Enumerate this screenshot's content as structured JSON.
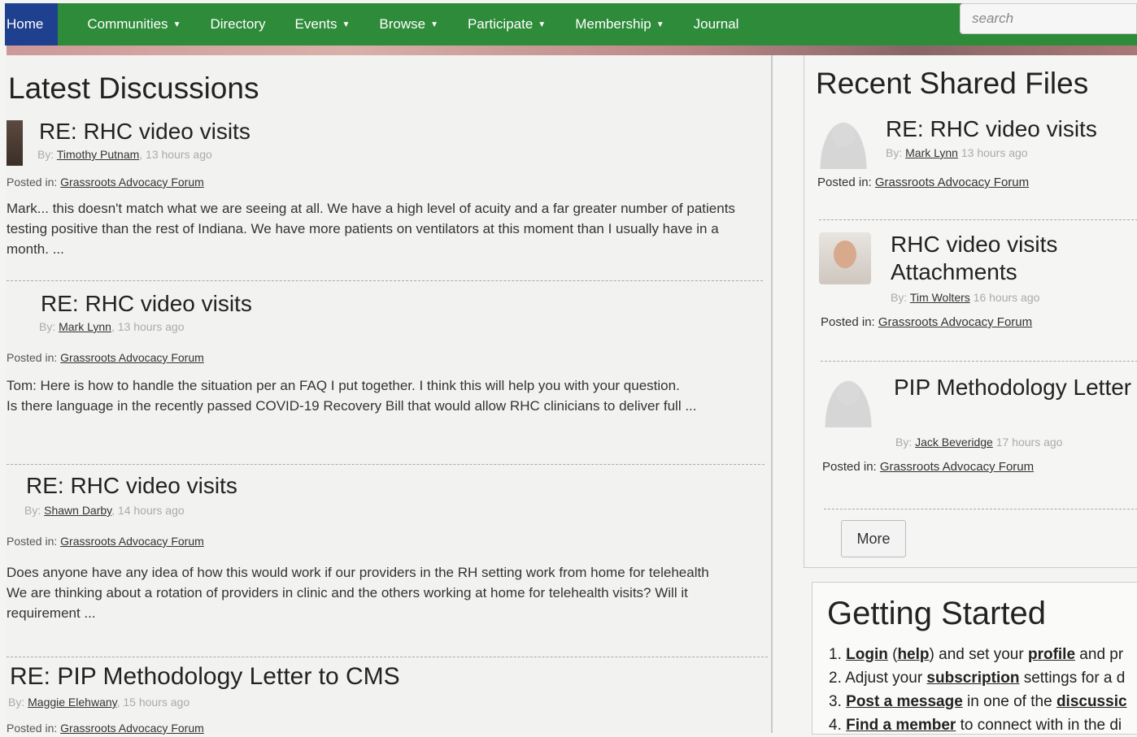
{
  "nav": {
    "home": "Home",
    "items": [
      {
        "label": "Communities",
        "caret": true
      },
      {
        "label": "Directory",
        "caret": false
      },
      {
        "label": "Events",
        "caret": true
      },
      {
        "label": "Browse",
        "caret": true
      },
      {
        "label": "Participate",
        "caret": true
      },
      {
        "label": "Membership",
        "caret": true
      },
      {
        "label": "Journal",
        "caret": false
      }
    ],
    "search_placeholder": "search"
  },
  "discussions": {
    "title": "Latest Discussions",
    "posts": [
      {
        "title": "RE: RHC video visits",
        "by": "By:",
        "author": "Timothy Putnam",
        "time": ", 13 hours ago",
        "posted_in": "Posted in:",
        "forum": "Grassroots Advocacy Forum",
        "body": "Mark... this doesn't match what we are seeing at all. We have a high level of acuity and a far greater number of patients testing positive than the rest of Indiana. We have more patients on ventilators at this moment than I usually have in a month. ..."
      },
      {
        "title": "RE: RHC video visits",
        "by": "By:",
        "author": "Mark Lynn",
        "time": ", 13 hours ago",
        "posted_in": "Posted in:",
        "forum": "Grassroots Advocacy Forum",
        "body": "Tom: Here is how to handle the situation per an FAQ I put together. I think this will help you with your question.\n Is there language in the recently passed COVID-19 Recovery Bill that would allow RHC clinicians to deliver full ..."
      },
      {
        "title": "RE: RHC video visits",
        "by": "By:",
        "author": "Shawn Darby",
        "time": ", 14 hours ago",
        "posted_in": "Posted in:",
        "forum": "Grassroots Advocacy Forum",
        "body": "Does anyone have any idea of how this would work if our providers in the RH setting work from home for telehealth\nWe are thinking about a rotation of providers in clinic and the others working at home for telehealth visits?   Will it requirement ..."
      },
      {
        "title": "RE: PIP Methodology Letter to CMS",
        "by": "By:",
        "author": "Maggie Elehwany",
        "time": ", 15 hours ago",
        "posted_in": "Posted in:",
        "forum": "Grassroots Advocacy Forum",
        "body": ""
      }
    ]
  },
  "shared_files": {
    "title": "Recent Shared Files",
    "files": [
      {
        "title": "RE: RHC video visits",
        "by": "By:",
        "author": "Mark Lynn",
        "time": "13 hours ago",
        "posted_in": "Posted in:",
        "forum": "Grassroots Advocacy Forum"
      },
      {
        "title": "RHC video visits Attachments",
        "by": "By:",
        "author": "Tim Wolters",
        "time": "16 hours ago",
        "posted_in": "Posted in:",
        "forum": "Grassroots Advocacy Forum"
      },
      {
        "title": "PIP Methodology Letter CMS Attachments",
        "by": "By:",
        "author": "Jack Beveridge",
        "time": "17 hours ago",
        "posted_in": "Posted in:",
        "forum": "Grassroots Advocacy Forum"
      }
    ],
    "more_label": "More"
  },
  "getting_started": {
    "title": "Getting Started",
    "steps": [
      {
        "num": "1.",
        "link1": "Login",
        "t1": " (",
        "link2": "help",
        "t2": ") and set your ",
        "link3": "profile",
        "t3": " and pr"
      },
      {
        "num": "2.",
        "pre": "Adjust your ",
        "link1": "subscription",
        "t1": " settings for a d"
      },
      {
        "num": "3.",
        "link1": "Post a message",
        "t1": " in one of the ",
        "link2": "discussic"
      },
      {
        "num": "4.",
        "link1": "Find a member",
        "t1": " to connect with in the di"
      }
    ]
  }
}
